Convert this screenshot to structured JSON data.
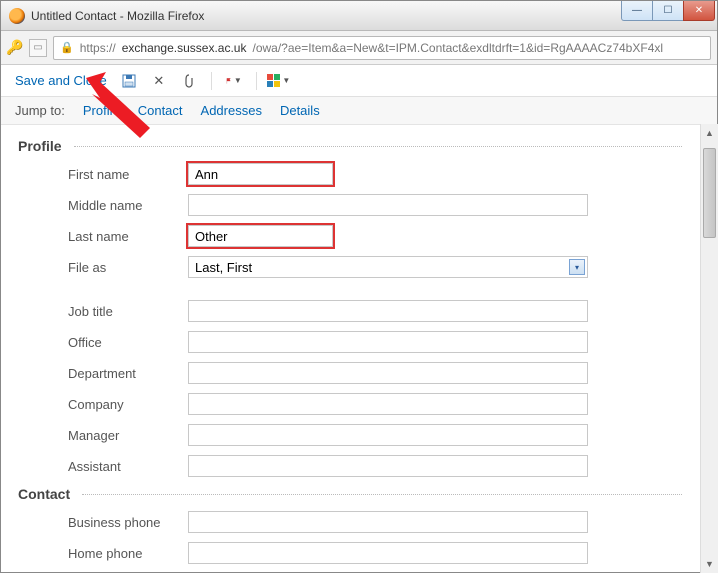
{
  "window": {
    "title": "Untitled Contact - Mozilla Firefox"
  },
  "url": {
    "scheme": "https://",
    "host": "exchange.sussex.ac.uk",
    "path": "/owa/?ae=Item&a=New&t=IPM.Contact&exdltdrft=1&id=RgAAAACz74bXF4xl"
  },
  "toolbar": {
    "save_and_close": "Save and Close"
  },
  "jump": {
    "label": "Jump to:",
    "tabs": {
      "profile": "Profile",
      "contact": "Contact",
      "addresses": "Addresses",
      "details": "Details"
    }
  },
  "sections": {
    "profile": {
      "heading": "Profile",
      "fields": {
        "first_name": {
          "label": "First name",
          "value": "Ann"
        },
        "middle_name": {
          "label": "Middle name",
          "value": ""
        },
        "last_name": {
          "label": "Last name",
          "value": "Other"
        },
        "file_as": {
          "label": "File as",
          "value": "Last, First"
        },
        "job_title": {
          "label": "Job title",
          "value": ""
        },
        "office": {
          "label": "Office",
          "value": ""
        },
        "department": {
          "label": "Department",
          "value": ""
        },
        "company": {
          "label": "Company",
          "value": ""
        },
        "manager": {
          "label": "Manager",
          "value": ""
        },
        "assistant": {
          "label": "Assistant",
          "value": ""
        }
      }
    },
    "contact": {
      "heading": "Contact",
      "fields": {
        "business_phone": {
          "label": "Business phone",
          "value": ""
        },
        "home_phone": {
          "label": "Home phone",
          "value": ""
        }
      }
    }
  }
}
